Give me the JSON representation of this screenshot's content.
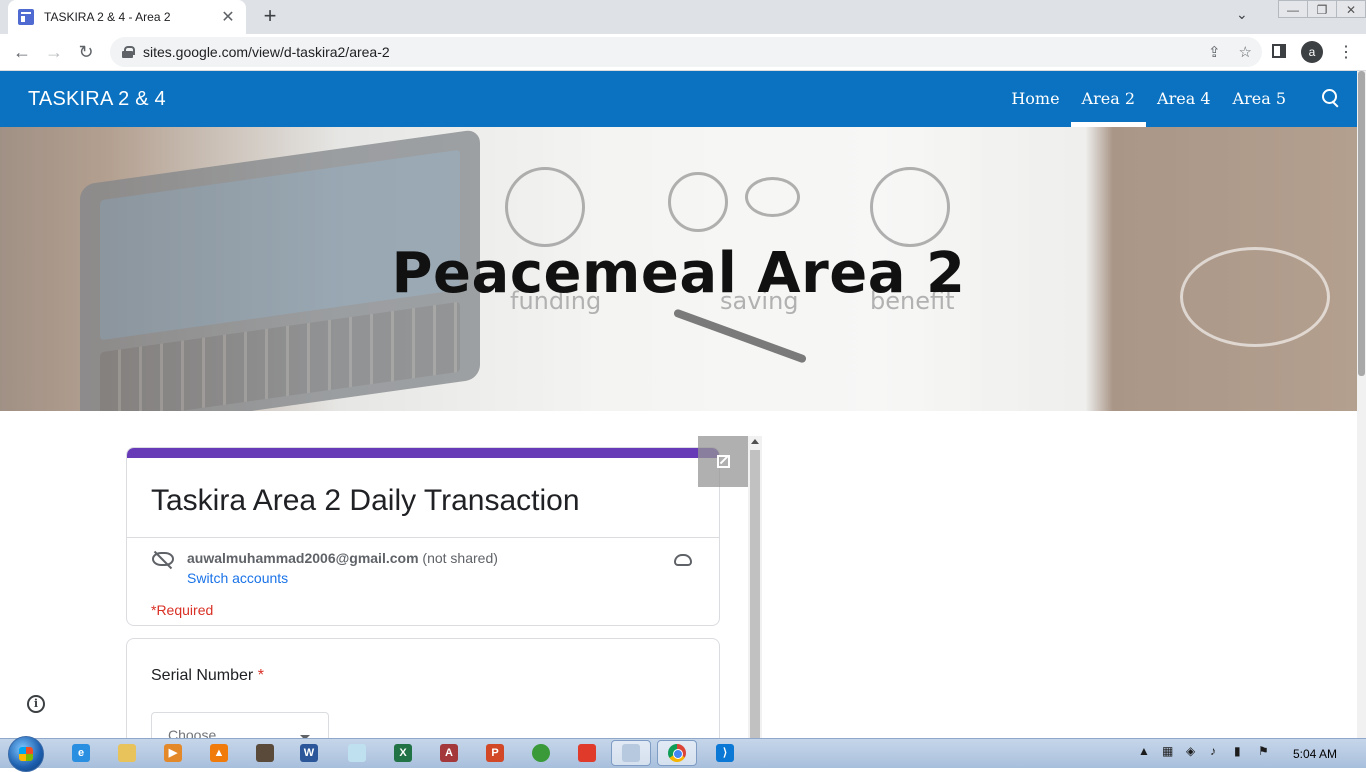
{
  "browser": {
    "tab_title": "TASKIRA 2 & 4 - Area 2",
    "tab_close": "✕",
    "new_tab": "+",
    "url": "sites.google.com/view/d-taskira2/area-2",
    "avatar_letter": "a"
  },
  "site": {
    "title": "TASKIRA 2 & 4",
    "nav": [
      {
        "label": "Home",
        "active": false
      },
      {
        "label": "Area 2",
        "active": true
      },
      {
        "label": "Area 4",
        "active": false
      },
      {
        "label": "Area 5",
        "active": false
      }
    ],
    "accent_color": "#0a72c0"
  },
  "hero": {
    "title": "Peacemeal Area 2",
    "sketch_labels": [
      "funding",
      "saving",
      "benefit"
    ]
  },
  "form": {
    "title": "Taskira Area 2 Daily Transaction",
    "account_email": "auwalmuhammad2006@gmail.com",
    "account_status": "(not shared)",
    "switch_accounts": "Switch accounts",
    "required_note": "*Required",
    "question_label": "Serial Number",
    "question_required_mark": "*",
    "select_placeholder": "Choose",
    "accent_color": "#673ab7"
  },
  "taskbar": {
    "clock": "5:04 AM"
  }
}
